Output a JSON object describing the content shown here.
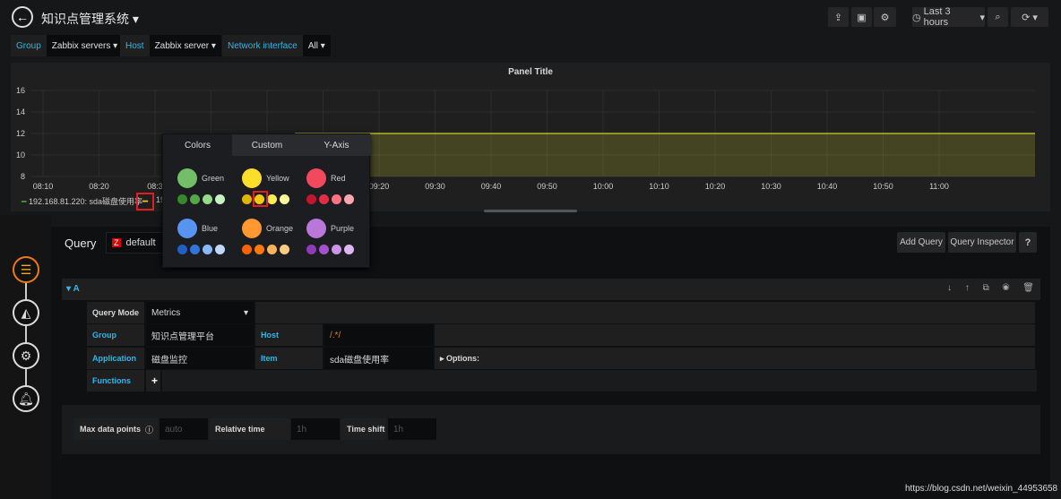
{
  "header": {
    "title": "知识点管理系统",
    "time_range": "Last 3 hours"
  },
  "variables": [
    {
      "label": "Group",
      "value": "Zabbix servers"
    },
    {
      "label": "Host",
      "value": "Zabbix server"
    },
    {
      "label": "Network interface",
      "value": "All"
    }
  ],
  "panel": {
    "title": "Panel Title",
    "legend": "192.168.81.220: sda磁盘使用率",
    "legend_extra": "19"
  },
  "chart_data": {
    "type": "area",
    "y_ticks": [
      "16",
      "14",
      "12",
      "10",
      "8"
    ],
    "ylim": [
      8,
      16
    ],
    "x_ticks": [
      "08:10",
      "08:20",
      "08:3",
      "",
      "",
      "09:10",
      "09:20",
      "09:30",
      "09:40",
      "09:50",
      "10:00",
      "10:10",
      "10:20",
      "10:30",
      "10:40",
      "10:50",
      "11:00"
    ],
    "series": [
      {
        "name": "192.168.81.220: sda磁盘使用率",
        "color": "#b6b428",
        "value": 12
      }
    ],
    "grid": true
  },
  "color_picker": {
    "tabs": [
      "Colors",
      "Custom",
      "Y-Axis"
    ],
    "colors": [
      {
        "name": "Green",
        "main": "#73bf69",
        "shades": [
          "#37872d",
          "#56a64b",
          "#96d98d",
          "#c8f2c2"
        ]
      },
      {
        "name": "Yellow",
        "main": "#fade2a",
        "shades": [
          "#e0b400",
          "#f2cc0c",
          "#ffee52",
          "#fff899"
        ]
      },
      {
        "name": "Red",
        "main": "#f2495c",
        "shades": [
          "#c4162a",
          "#e02f44",
          "#ff7383",
          "#ffa6b0"
        ]
      },
      {
        "name": "Blue",
        "main": "#5794f2",
        "shades": [
          "#1f60c4",
          "#3274d9",
          "#8ab8ff",
          "#c0d8ff"
        ]
      },
      {
        "name": "Orange",
        "main": "#ff9830",
        "shades": [
          "#fa6400",
          "#ff780a",
          "#ffb357",
          "#ffcb7d"
        ]
      },
      {
        "name": "Purple",
        "main": "#b877d9",
        "shades": [
          "#8f3bb8",
          "#a352cc",
          "#ca95e5",
          "#deb6f2"
        ]
      }
    ]
  },
  "query": {
    "title": "Query",
    "datasource": "default",
    "add_query": "Add Query",
    "inspector": "Query Inspector",
    "help": "?",
    "ref": "A",
    "query_mode_label": "Query Mode",
    "query_mode": "Metrics",
    "group_label": "Group",
    "group": "知识点管理平台",
    "host_label": "Host",
    "host": "/.*/",
    "application_label": "Application",
    "application": "磁盘监控",
    "item_label": "Item",
    "item": "sda磁盘使用率",
    "options": "Options:",
    "functions_label": "Functions",
    "max_dp_label": "Max data points",
    "max_dp_placeholder": "auto",
    "relative_label": "Relative time",
    "relative_placeholder": "1h",
    "shift_label": "Time shift",
    "shift_placeholder": "1h"
  },
  "watermark": "https://blog.csdn.net/weixin_44953658"
}
